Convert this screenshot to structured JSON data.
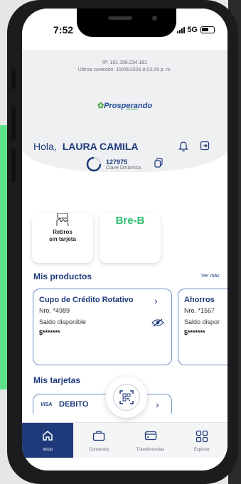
{
  "status_bar": {
    "time": "7:52",
    "network": "5G"
  },
  "session": {
    "ip": "IP: 191.156.234.181",
    "last_connection": "Última conexión: 15/06/2026 8:03:29 p. m."
  },
  "brand": {
    "prefix": "Prosp",
    "underlined": "era",
    "suffix": "ndo"
  },
  "greeting": {
    "hello": "Hola,",
    "name": "LAURA CAMILA"
  },
  "dynamic_key": {
    "code": "127975",
    "label": "Clave Dinámica"
  },
  "quick_actions": [
    {
      "label_line1": "Retiros",
      "label_line2": "sin tarjeta"
    },
    {
      "label": "Bre-B"
    }
  ],
  "products": {
    "title": "Mis productos",
    "see_more": "Ver más",
    "items": [
      {
        "title": "Cupo de Crédito Rotativo",
        "number": "Nro. *4989",
        "balance_label": "Saldo disponible",
        "balance": "$*******"
      },
      {
        "title": "Ahorros",
        "number": "Nro. *1567",
        "balance_label": "Saldo dispor",
        "balance": "$*******"
      }
    ]
  },
  "cards": {
    "title": "Mis tarjetas",
    "items": [
      {
        "brand": "VISA",
        "type": "DEBITO"
      }
    ]
  },
  "nav": [
    {
      "label": "Inicio",
      "icon": "home-icon",
      "active": true
    },
    {
      "label": "Convenios",
      "icon": "briefcase-icon",
      "active": false
    },
    {
      "label": "Transferencias",
      "icon": "card-icon",
      "active": false
    },
    {
      "label": "Explorar",
      "icon": "grid-icon",
      "active": false
    }
  ],
  "colors": {
    "brand_blue": "#1e3a7a",
    "brand_green": "#2fc16f",
    "card_border": "#6e8cc8"
  }
}
